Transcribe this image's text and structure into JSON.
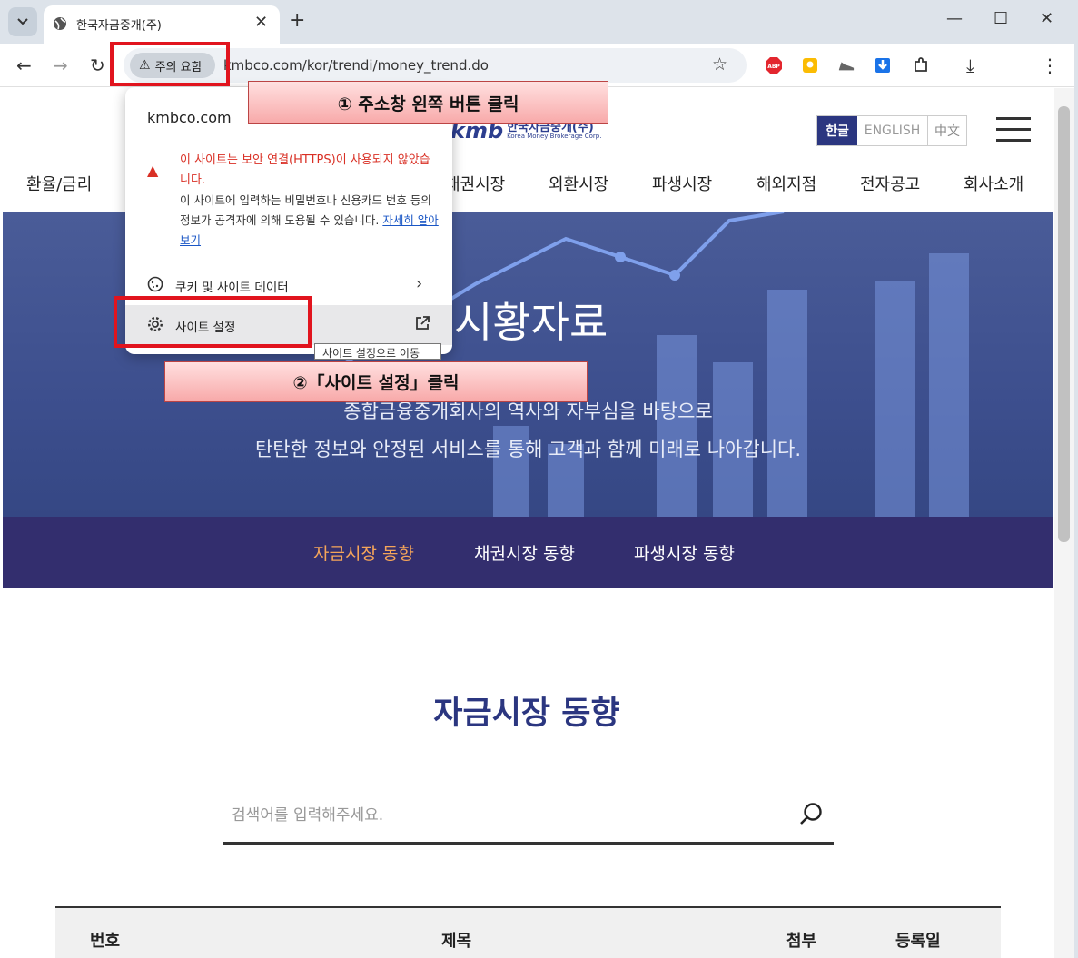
{
  "browser": {
    "tab_title": "한국자금중개(주)",
    "tab_close": "✕",
    "new_tab": "+",
    "window": {
      "minimize": "—",
      "maximize": "☐",
      "close": "✕"
    },
    "nav": {
      "back": "←",
      "forward": "→",
      "reload": "↻"
    },
    "security_chip": "주의 요함",
    "url": "kmbco.com/kor/trendi/money_trend.do",
    "bookmark": "☆",
    "download": "⤓",
    "menu": "⋮",
    "abp_label": "ABP"
  },
  "site": {
    "logo_mark": "kmb",
    "logo_ko": "한국자금중개(주)",
    "logo_en": "Korea Money Brokerage Corp.",
    "languages": [
      "한글",
      "ENGLISH",
      "中文"
    ],
    "gnb": [
      "환율/금리",
      "채권시장",
      "외환시장",
      "파생시장",
      "해외지점",
      "전자공고",
      "회사소개"
    ],
    "hero_title": "시황자료",
    "hero_sub1": "종합금융중개회사의 역사와 자부심을 바탕으로",
    "hero_sub2": "탄탄한 정보와 안정된 서비스를 통해 고객과 함께 미래로 나아갑니다.",
    "subnav": [
      "자금시장 동향",
      "채권시장 동향",
      "파생시장 동향"
    ],
    "section_title": "자금시장 동향",
    "search_placeholder": "검색어를 입력해주세요.",
    "table_headers": [
      "번호",
      "제목",
      "첨부",
      "등록일"
    ]
  },
  "popup": {
    "host": "kmbco.com",
    "warning_title": "이 사이트는 보안 연결(HTTPS)이 사용되지 않았습니다.",
    "warning_body": "이 사이트에 입력하는 비밀번호나 신용카드 번호 등의 정보가 공격자에 의해 도용될 수 있습니다.",
    "learn_more": "자세히 알아보기",
    "cookie_label": "쿠키 및 사이트 데이터",
    "site_settings_label": "사이트 설정",
    "tooltip": "사이트 설정으로 이동"
  },
  "annotations": {
    "step1": "① 주소창 왼쪽 버튼 클릭",
    "step2": "②「사이트 설정」클릭",
    "highlight_color": "#e1141e"
  },
  "colors": {
    "brand_navy": "#2b3680",
    "subnav_bg": "#332e6e",
    "subnav_active": "#f5a55a",
    "warning_red": "#d93025"
  }
}
